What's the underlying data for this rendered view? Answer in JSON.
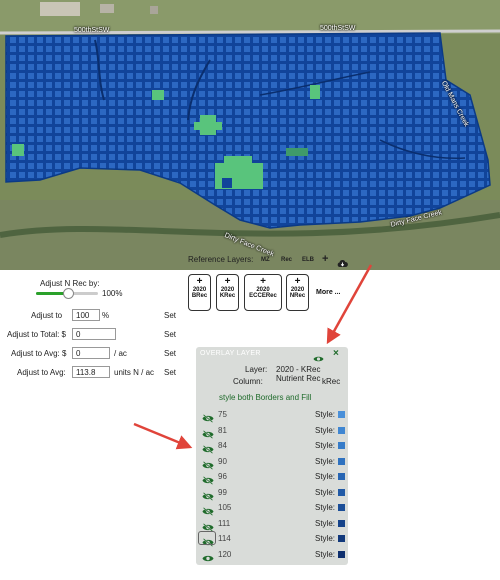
{
  "map": {
    "road_labels": [
      "500thStSW",
      "500thStSW"
    ],
    "creek_labels": [
      "Old Mans Creek",
      "Dirty Face Creek",
      "Dirty Face Creek"
    ],
    "colors": {
      "field": "#11449a",
      "cell_light": "#2a66c0",
      "green_zone": "#59c47c",
      "land": "#6f7e52"
    }
  },
  "adjust": {
    "slider_label": "Adjust N Rec by:",
    "slider_value": "100%",
    "slider_fraction": 0.5,
    "rows": [
      {
        "label": "Adjust to",
        "value": "100",
        "unit": "%",
        "set": "Set"
      },
      {
        "label": "Adjust to Total: $",
        "value": "0",
        "unit": "",
        "set": "Set"
      },
      {
        "label": "Adjust to Avg: $",
        "value": "0",
        "unit": "/ ac",
        "set": "Set"
      },
      {
        "label": "Adjust to Avg:",
        "value": "113.8",
        "unit": "units N / ac",
        "set": "Set"
      }
    ]
  },
  "reference": {
    "label": "Reference Layers:",
    "buttons": [
      "MZ",
      "Rec",
      "ELB"
    ],
    "tiles": [
      {
        "year": "2020",
        "name": "BRec"
      },
      {
        "year": "2020",
        "name": "KRec"
      },
      {
        "year": "2020",
        "name": "ECCERec"
      },
      {
        "year": "2020",
        "name": "NRec"
      }
    ],
    "more": "More ..."
  },
  "overlay": {
    "title": "OVERLAY LAYER",
    "layer_label": "Layer:",
    "layer_value": "2020 - KRec Nutrient Rec",
    "column_label": "Column:",
    "column_value": "kRec",
    "style_link": "style both Borders and Fill",
    "style_label": "Style:",
    "legend": [
      {
        "value": "75",
        "color": "#4a90d9",
        "visible": false
      },
      {
        "value": "81",
        "color": "#3f86d2",
        "visible": false
      },
      {
        "value": "84",
        "color": "#377cc9",
        "visible": false
      },
      {
        "value": "90",
        "color": "#2f72c0",
        "visible": false
      },
      {
        "value": "96",
        "color": "#2866b4",
        "visible": false
      },
      {
        "value": "99",
        "color": "#215aa6",
        "visible": false
      },
      {
        "value": "105",
        "color": "#1b4e98",
        "visible": false
      },
      {
        "value": "111",
        "color": "#16438a",
        "visible": false
      },
      {
        "value": "114",
        "color": "#12397c",
        "visible": false
      },
      {
        "value": "120",
        "color": "#0e2f6e",
        "visible": true
      }
    ]
  },
  "accent": {
    "green": "#2aa12a",
    "dark_green": "#1f6b2b",
    "arrow_red": "#e0443a"
  }
}
